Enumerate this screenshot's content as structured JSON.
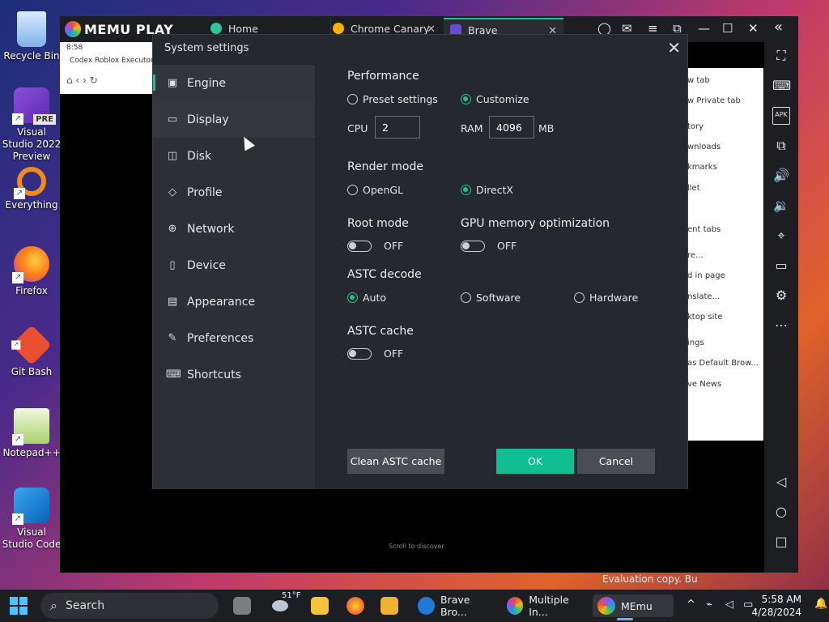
{
  "desktop": {
    "icons": [
      {
        "label": "Recycle Bin"
      },
      {
        "label": "Visual Studio 2022 Preview",
        "badge": "PRE"
      },
      {
        "label": "Everything"
      },
      {
        "label": "Firefox"
      },
      {
        "label": "Git Bash"
      },
      {
        "label": "Notepad++"
      },
      {
        "label": "Visual Studio Code"
      }
    ],
    "watermark": "Evaluation copy. Bu"
  },
  "memu": {
    "logo": "MEMU PLAY",
    "tabs": [
      {
        "label": "Home",
        "color": "#2fc3a0"
      },
      {
        "label": "Chrome Canary",
        "color": "#f4b400"
      },
      {
        "label": "Brave",
        "color": "#6a4bd4"
      }
    ],
    "window_controls": {
      "minimize": "—",
      "maximize": "☐",
      "close": "✕",
      "collapse": "«"
    },
    "side_icons": [
      "fullscreen-icon",
      "keyboard-icon",
      "apk-icon",
      "multi-window-icon",
      "volume-up-icon",
      "volume-down-icon",
      "location-icon",
      "folder-icon",
      "settings-icon",
      "more-icon",
      "back-icon",
      "home-icon",
      "recents-icon"
    ],
    "apk_label": "APK",
    "chrome_time": "8:58",
    "chrome_tab": "Codex Roblox Executor",
    "chrome_menu": [
      "w tab",
      "w Private tab",
      "tory",
      "wnloads",
      "kmarks",
      "llet",
      "ent tabs",
      "re...",
      "d in page",
      "nslate...",
      "ktop site",
      "ings",
      "as Default Brow...",
      "ve News"
    ],
    "scroll_hint": "Scroll to discover"
  },
  "dialog": {
    "title": "System settings",
    "nav": [
      {
        "label": "Engine",
        "icon": "chip-icon"
      },
      {
        "label": "Display",
        "icon": "monitor-icon"
      },
      {
        "label": "Disk",
        "icon": "disk-icon"
      },
      {
        "label": "Profile",
        "icon": "tag-icon"
      },
      {
        "label": "Network",
        "icon": "globe-icon"
      },
      {
        "label": "Device",
        "icon": "phone-icon"
      },
      {
        "label": "Appearance",
        "icon": "window-icon"
      },
      {
        "label": "Preferences",
        "icon": "wrench-icon"
      },
      {
        "label": "Shortcuts",
        "icon": "keyboard-icon"
      }
    ],
    "performance": {
      "title": "Performance",
      "preset_label": "Preset settings",
      "customize_label": "Customize",
      "selected": "Customize",
      "cpu_label": "CPU",
      "cpu_value": "2",
      "ram_label": "RAM",
      "ram_value": "4096",
      "ram_unit": "MB"
    },
    "render": {
      "title": "Render mode",
      "opengl_label": "OpenGL",
      "directx_label": "DirectX",
      "selected": "DirectX"
    },
    "root": {
      "title": "Root mode",
      "state": "OFF"
    },
    "gpu": {
      "title": "GPU memory optimization",
      "state": "OFF"
    },
    "astc_decode": {
      "title": "ASTC decode",
      "auto_label": "Auto",
      "software_label": "Software",
      "hardware_label": "Hardware",
      "selected": "Auto"
    },
    "astc_cache": {
      "title": "ASTC cache",
      "state": "OFF"
    },
    "buttons": {
      "clean": "Clean ASTC cache",
      "ok": "OK",
      "cancel": "Cancel"
    },
    "accent_color": "#15c39a"
  },
  "taskbar": {
    "search_placeholder": "Search",
    "weather": "51°F",
    "items": [
      {
        "label": "Brave Bro...",
        "color": "#1f7ad8"
      },
      {
        "label": "Multiple In...",
        "color": "#e0632a"
      },
      {
        "label": "MEmu",
        "color": "#a44de0"
      }
    ],
    "time": "5:58 AM",
    "date": "4/28/2024",
    "tray_chevron": "^"
  }
}
